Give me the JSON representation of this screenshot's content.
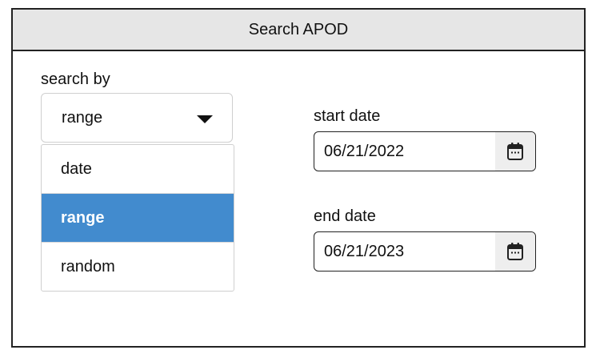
{
  "header": {
    "title": "Search APOD"
  },
  "search_by": {
    "label": "search by",
    "selected": "range",
    "options": [
      "date",
      "range",
      "random"
    ],
    "selected_index": 1
  },
  "start_date": {
    "label": "start date",
    "value": "06/21/2022"
  },
  "end_date": {
    "label": "end date",
    "value": "06/21/2023"
  },
  "icons": {
    "caret": "caret-down-icon",
    "calendar": "calendar-icon"
  },
  "colors": {
    "selected_option": "#428bce",
    "header_bg": "#e6e6e6"
  }
}
